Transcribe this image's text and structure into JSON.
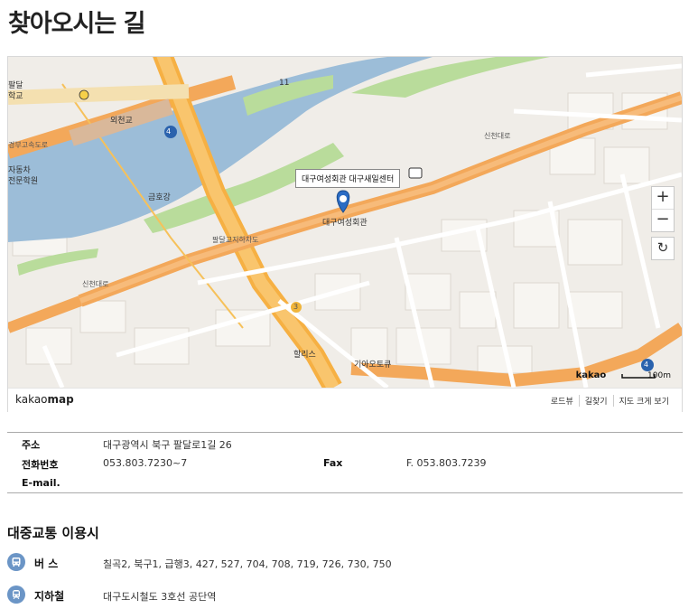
{
  "page": {
    "title": "찾아오시는 길"
  },
  "map": {
    "marker_title": "대구여성회관 대구새일센터",
    "marker_place": "대구여성회관",
    "labels": {
      "river": "금호강",
      "bridge": "외천교",
      "road_sincheon_top": "신천대로",
      "road_sincheon_left": "신천대로",
      "expressway": "경부고속도로",
      "school_a": "팔달",
      "school_b": "학교",
      "auto_a": "자동차",
      "auto_b": "전문학원",
      "place_hallis": "할리스",
      "place_kia": "기아오토큐",
      "route_11": "11",
      "route_4a": "4",
      "route_4b": "4",
      "route_3": "3",
      "road_paldal": "팔달교지하차도"
    },
    "controls": {
      "zoom_in": "+",
      "zoom_out": "−",
      "reset": "↻"
    },
    "scale": {
      "brand": "kakao",
      "distance": "100m"
    },
    "footer": {
      "logo_plain": "kakao",
      "logo_bold": "map",
      "links": [
        "로드뷰",
        "길찾기",
        "지도 크게 보기"
      ]
    }
  },
  "info": {
    "address_label": "주소",
    "address_value": "대구광역시 북구 팔달로1길 26",
    "phone_label": "전화번호",
    "phone_value": "053.803.7230~7",
    "fax_label": "Fax",
    "fax_value": "F. 053.803.7239",
    "email_label": "E-mail."
  },
  "transit": {
    "title": "대중교통 이용시",
    "bus_label": "버 스",
    "bus_value": "칠곡2, 북구1, 급행3, 427, 527, 704, 708, 719, 726, 730, 750",
    "subway_label": "지하철",
    "subway_value": "대구도시철도 3호선 공단역"
  }
}
